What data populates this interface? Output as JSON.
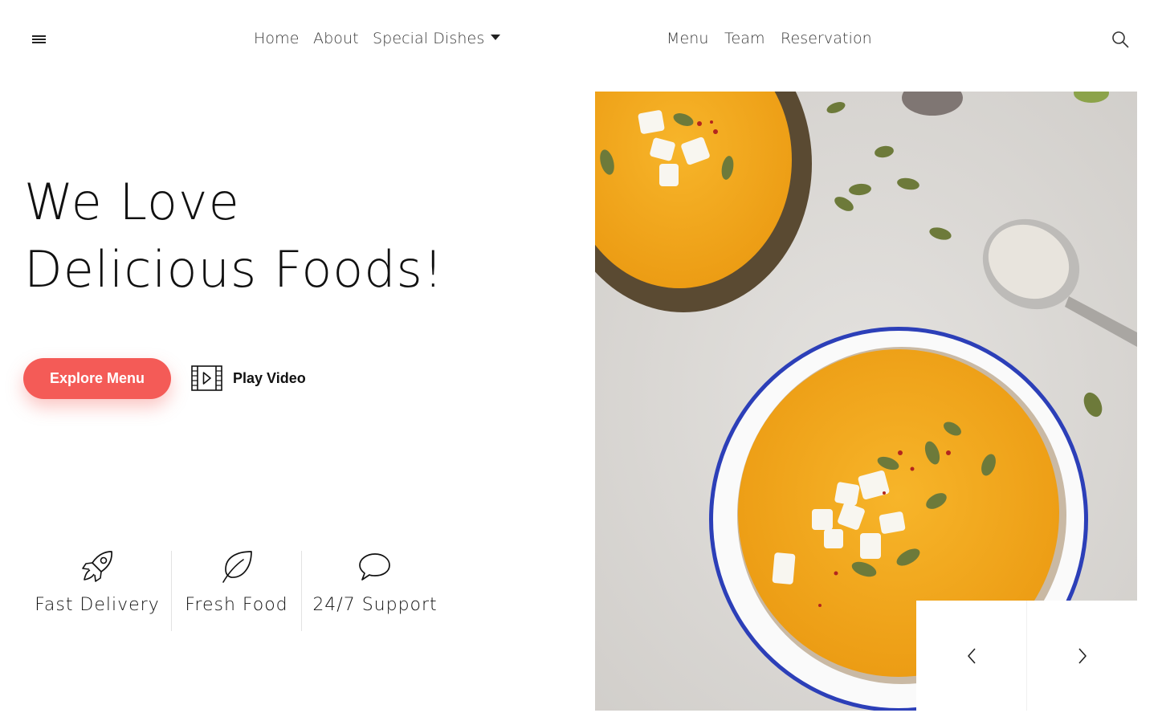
{
  "header": {
    "menu_icon": "hamburger-icon",
    "nav_left": [
      "Home",
      "About",
      "Special Dishes"
    ],
    "nav_right": [
      "Menu",
      "Team",
      "Reservation"
    ],
    "search_icon": "search-icon"
  },
  "hero": {
    "title_line1": "We Love",
    "title_line2": "Delicious Foods!",
    "explore_label": "Explore Menu",
    "play_label": "Play Video",
    "accent_color": "#f45b57"
  },
  "features": [
    {
      "label": "Fast Delivery",
      "icon": "rocket-icon"
    },
    {
      "label": "Fresh Food",
      "icon": "leaf-icon"
    },
    {
      "label": "24/7 Support",
      "icon": "speech-bubble-icon"
    }
  ],
  "slider": {
    "prev_icon": "chevron-left-icon",
    "next_icon": "chevron-right-icon"
  }
}
